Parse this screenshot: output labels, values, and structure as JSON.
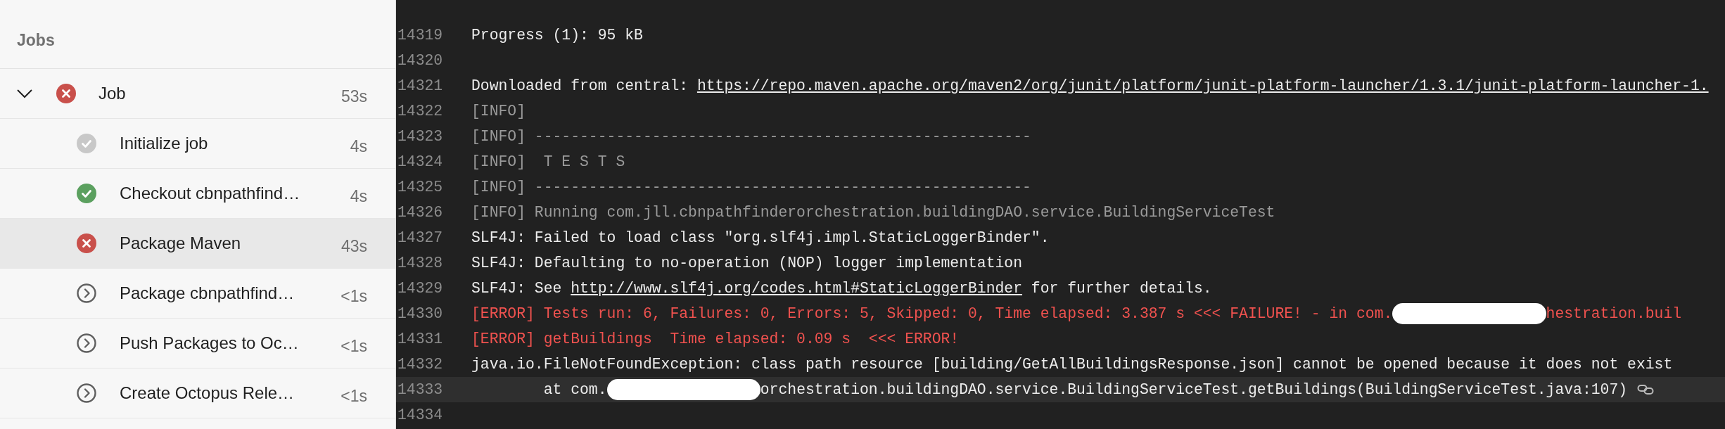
{
  "sidebar": {
    "title": "Jobs",
    "job": {
      "name": "Job",
      "kind": "failed",
      "duration": "53s",
      "expanded": true,
      "steps": [
        {
          "name": "Initialize job",
          "kind": "skipped",
          "duration": "4s",
          "selected": false
        },
        {
          "name": "Checkout cbnpathfind…",
          "kind": "succeeded",
          "duration": "4s",
          "selected": false
        },
        {
          "name": "Package Maven",
          "kind": "failed",
          "duration": "43s",
          "selected": true
        },
        {
          "name": "Package cbnpathfind…",
          "kind": "pending",
          "duration": "<1s",
          "selected": false
        },
        {
          "name": "Push Packages to Oc…",
          "kind": "pending",
          "duration": "<1s",
          "selected": false
        },
        {
          "name": "Create Octopus Rele…",
          "kind": "pending",
          "duration": "<1s",
          "selected": false
        }
      ]
    }
  },
  "log": {
    "lines": [
      {
        "number": "14319",
        "kind": "plain",
        "selected": false,
        "parts": [
          {
            "kind": "text",
            "text": "Progress (1): 95 kB"
          }
        ]
      },
      {
        "number": "14320",
        "kind": "plain",
        "selected": false
      },
      {
        "number": "14321",
        "kind": "plain",
        "selected": false,
        "parts": [
          {
            "kind": "text",
            "text": "Downloaded from central: "
          },
          {
            "kind": "link",
            "text": "https://repo.maven.apache.org/maven2/org/junit/platform/junit-platform-launcher/1.3.1/junit-platform-launcher-1."
          }
        ]
      },
      {
        "number": "14322",
        "kind": "info",
        "selected": false,
        "parts": [
          {
            "kind": "text",
            "text": "[INFO]"
          }
        ]
      },
      {
        "number": "14323",
        "kind": "info",
        "selected": false,
        "parts": [
          {
            "kind": "text",
            "text": "[INFO] -------------------------------------------------------"
          }
        ]
      },
      {
        "number": "14324",
        "kind": "info",
        "selected": false,
        "parts": [
          {
            "kind": "text",
            "text": "[INFO]  T E S T S"
          }
        ]
      },
      {
        "number": "14325",
        "kind": "info",
        "selected": false,
        "parts": [
          {
            "kind": "text",
            "text": "[INFO] -------------------------------------------------------"
          }
        ]
      },
      {
        "number": "14326",
        "kind": "info",
        "selected": false,
        "parts": [
          {
            "kind": "text",
            "text": "[INFO] Running com.jll.cbnpathfinderorchestration.buildingDAO.service.BuildingServiceTest"
          }
        ]
      },
      {
        "number": "14327",
        "kind": "plain",
        "selected": false,
        "parts": [
          {
            "kind": "text",
            "text": "SLF4J: Failed to load class \"org.slf4j.impl.StaticLoggerBinder\"."
          }
        ]
      },
      {
        "number": "14328",
        "kind": "plain",
        "selected": false,
        "parts": [
          {
            "kind": "text",
            "text": "SLF4J: Defaulting to no-operation (NOP) logger implementation"
          }
        ]
      },
      {
        "number": "14329",
        "kind": "plain",
        "selected": false,
        "parts": [
          {
            "kind": "text",
            "text": "SLF4J: See "
          },
          {
            "kind": "link",
            "text": "http://www.slf4j.org/codes.html#StaticLoggerBinder"
          },
          {
            "kind": "text",
            "text": " for further details."
          }
        ]
      },
      {
        "number": "14330",
        "kind": "error",
        "selected": false,
        "parts": [
          {
            "kind": "text",
            "text": "[ERROR] Tests run: 6, Failures: 0, Errors: 5, Skipped: 0, Time elapsed: 3.387 s <<< FAILURE! - in com."
          },
          {
            "kind": "redaction"
          },
          {
            "kind": "text",
            "text": "hestration.buil"
          }
        ]
      },
      {
        "number": "14331",
        "kind": "error",
        "selected": false,
        "parts": [
          {
            "kind": "text",
            "text": "[ERROR] getBuildings  Time elapsed: 0.09 s  <<< ERROR!"
          }
        ]
      },
      {
        "number": "14332",
        "kind": "plain",
        "selected": false,
        "parts": [
          {
            "kind": "text",
            "text": "java.io.FileNotFoundException: class path resource [building/GetAllBuildingsResponse.json] cannot be opened because it does not exist"
          }
        ]
      },
      {
        "number": "14333",
        "kind": "plain",
        "selected": true,
        "parts": [
          {
            "kind": "text",
            "text": "        at com."
          },
          {
            "kind": "redaction"
          },
          {
            "kind": "text",
            "text": "orchestration.buildingDAO.service.BuildingServiceTest.getBuildings(BuildingServiceTest.java:107)"
          }
        ]
      },
      {
        "number": "14334",
        "kind": "plain",
        "selected": false
      }
    ]
  }
}
